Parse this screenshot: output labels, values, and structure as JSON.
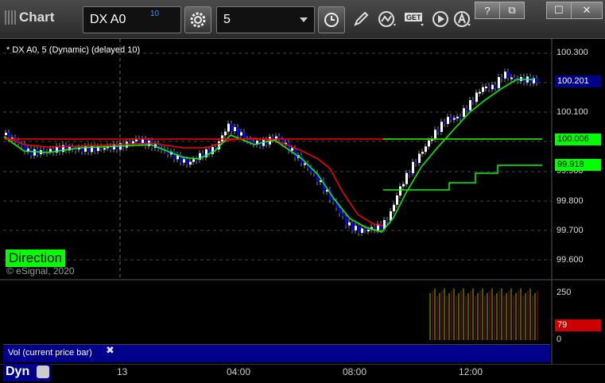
{
  "app": {
    "title": "Chart"
  },
  "toolbar": {
    "symbol": "DX A0",
    "symbol_delay": "10",
    "interval": "5",
    "get_label": "GET"
  },
  "window_buttons": {
    "help": "?",
    "restore": "⧉",
    "maximize": "☐",
    "close": "✕"
  },
  "chart": {
    "label": "* DX A0, 5 (Dynamic) (delayed 10)",
    "direction_label": "Direction",
    "copyright": "© eSignal, 2020",
    "price_ticks": [
      "100.300",
      "100.100",
      "99.900",
      "99.800",
      "99.700",
      "99.600"
    ],
    "last_price": "100.201",
    "green_line_price": "100.006",
    "green_line2_price": "99.918",
    "volume_ticks": [
      "250",
      "0"
    ],
    "volume_value": "79",
    "volume_label": "Vol (current price bar)",
    "time_labels": [
      "13",
      "04:00",
      "08:00",
      "12:00"
    ],
    "mode_label": "Dyn",
    "colors": {
      "up": "#ffffff",
      "down": "#0000ff",
      "red_line": "#ff0000",
      "green_line": "#00ff00",
      "volume_badge": "#cc0000",
      "last_badge": "#00008b"
    }
  }
}
